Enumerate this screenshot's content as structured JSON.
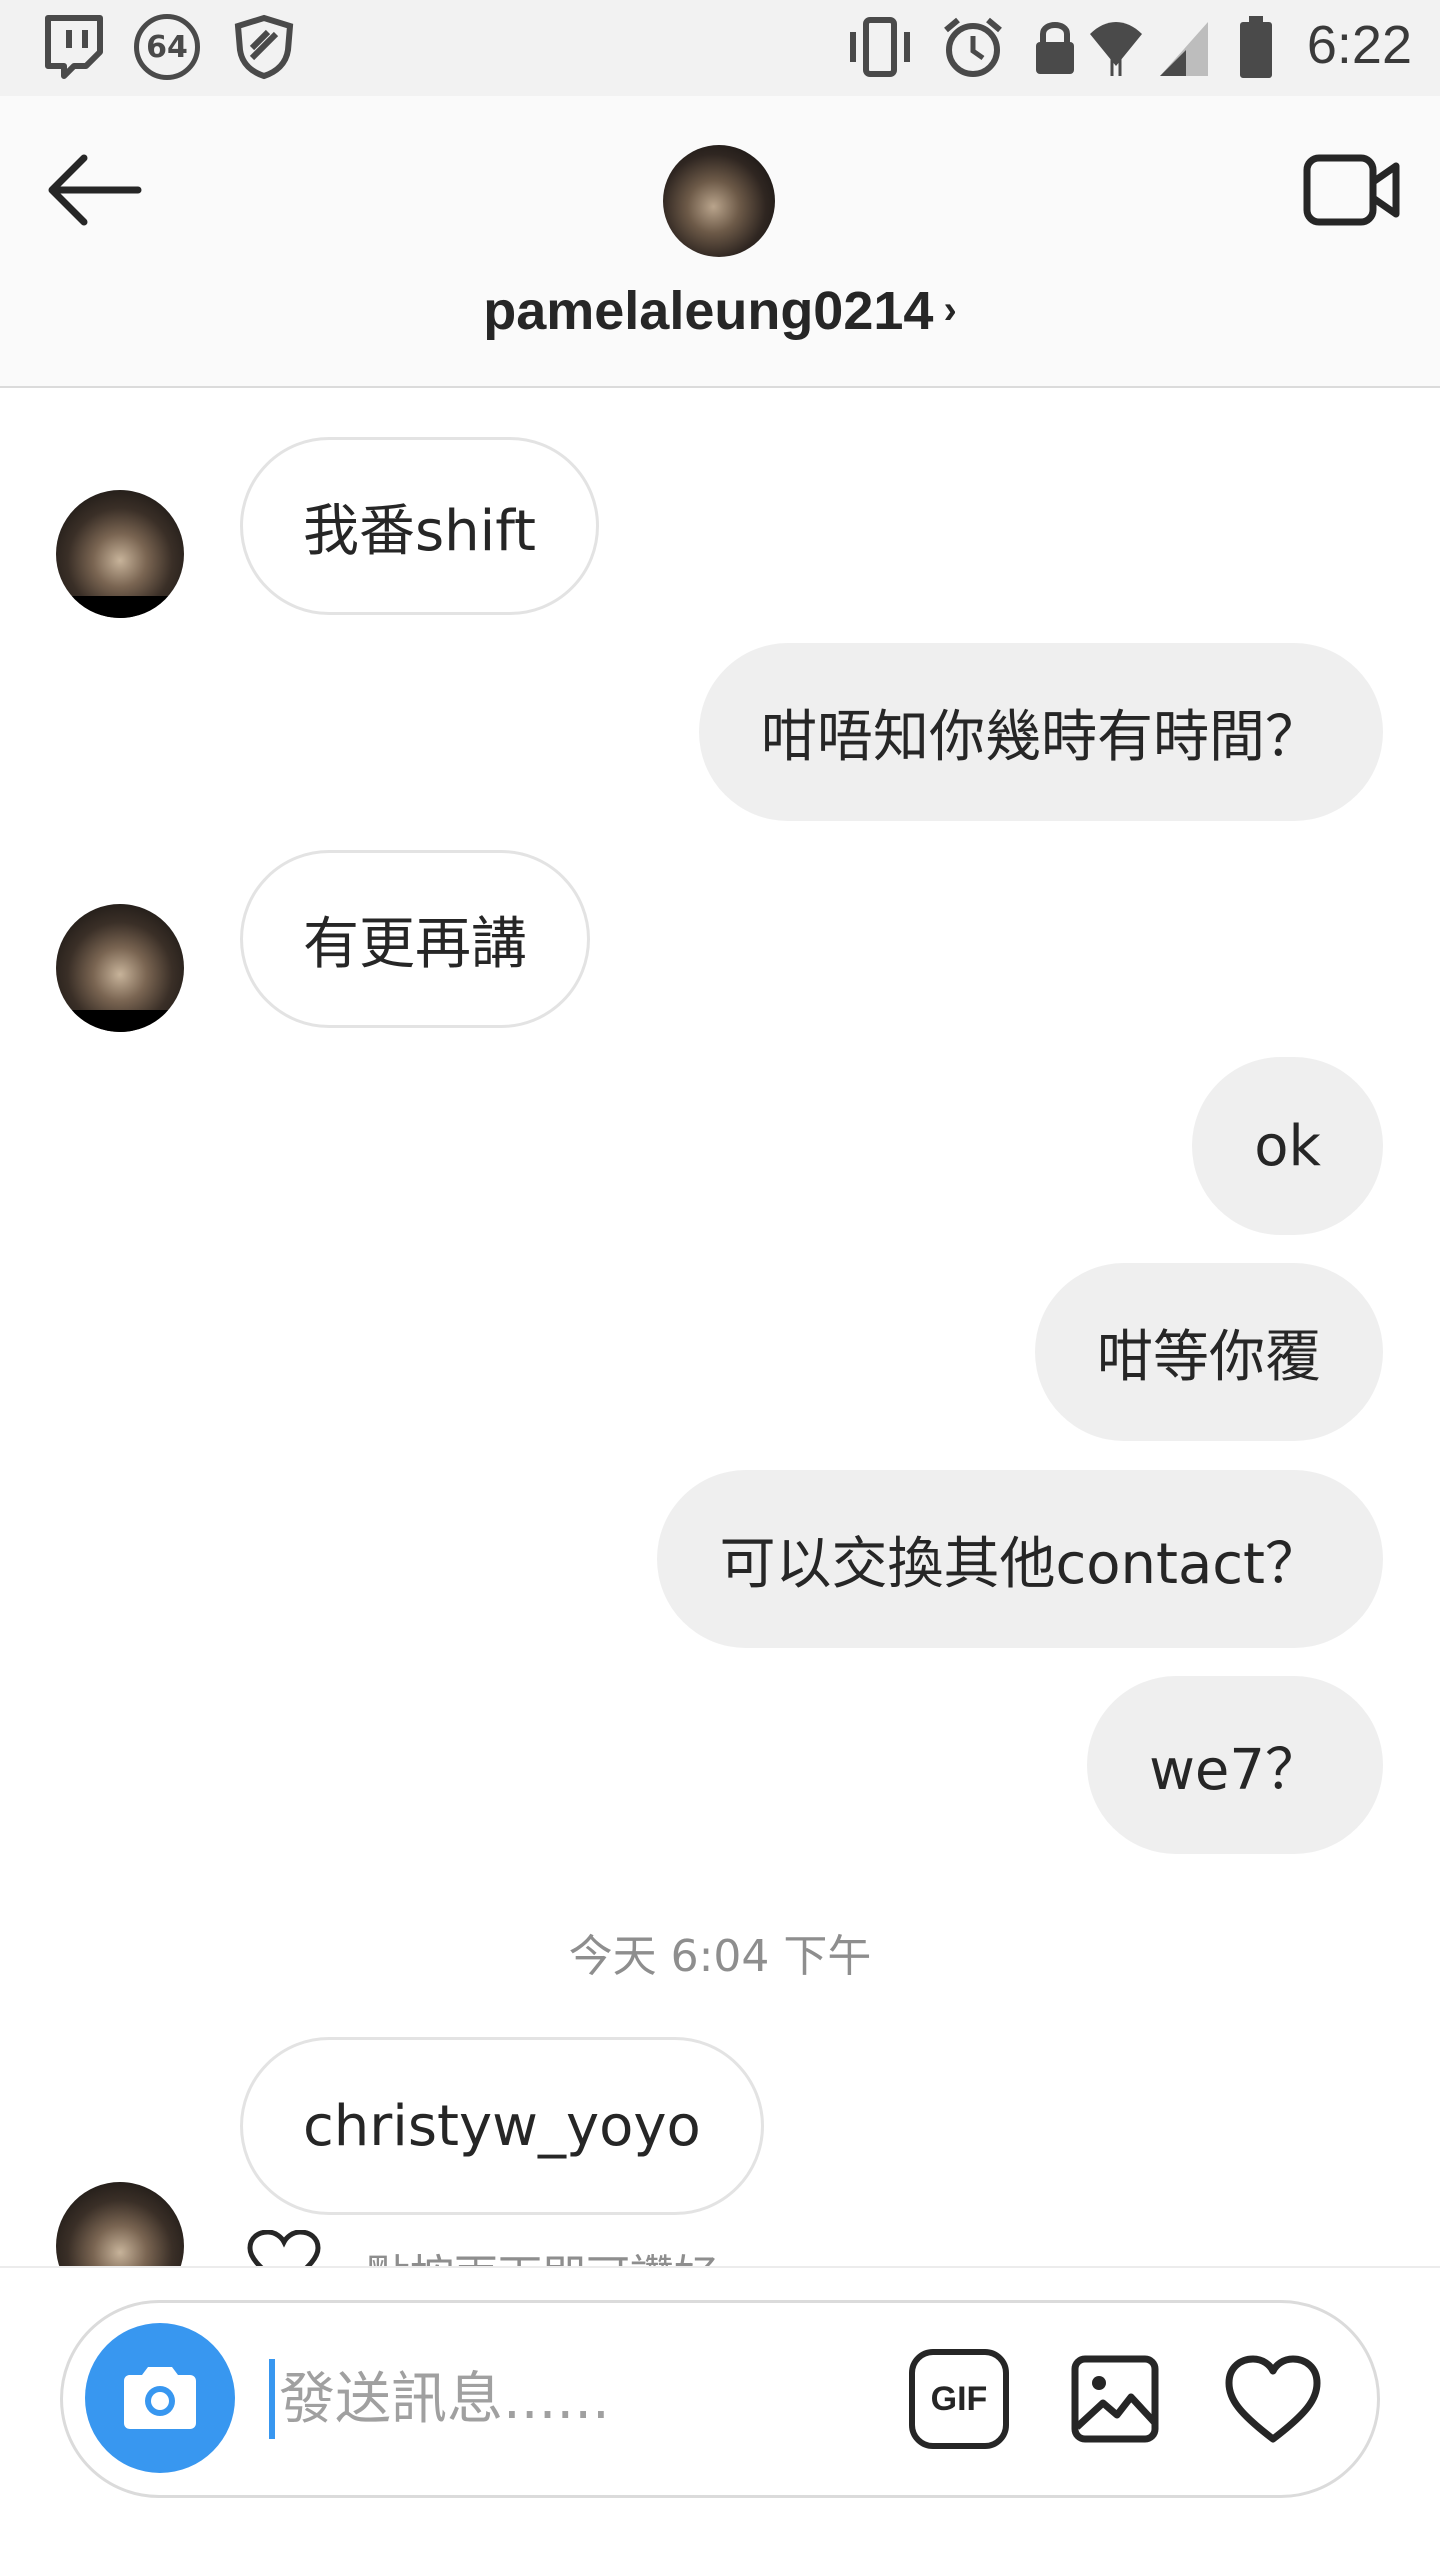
{
  "status_bar": {
    "time": "6:22",
    "icons": [
      "twitch-icon",
      "notification-count-icon",
      "shield-icon",
      "vibrate-icon",
      "alarm-icon",
      "lock-icon",
      "wifi-icon",
      "signal-icon",
      "battery-icon"
    ],
    "notification_count": "64"
  },
  "header": {
    "username": "pamelaleung0214",
    "chevron": "›",
    "back_icon": "back-arrow-icon",
    "video_icon": "video-call-icon"
  },
  "messages": [
    {
      "side": "in",
      "text": "我番shift"
    },
    {
      "side": "out",
      "text": "咁唔知你幾時有時間？"
    },
    {
      "side": "in",
      "text": "有更再講"
    },
    {
      "side": "out",
      "text": "ok"
    },
    {
      "side": "out",
      "text": "咁等你覆"
    },
    {
      "side": "out",
      "text": "可以交換其他contact？"
    },
    {
      "side": "out",
      "text": "we7？"
    },
    {
      "side": "in",
      "text": "christyw_yoyo"
    }
  ],
  "timestamp": "今天 6:04 下午",
  "like_hint": "點按兩下即可讚好",
  "composer": {
    "placeholder": "發送訊息......",
    "icons": [
      "camera-icon",
      "gif-icon",
      "gallery-icon",
      "heart-icon"
    ],
    "gif_label": "GIF",
    "accent": "#3897f0"
  }
}
